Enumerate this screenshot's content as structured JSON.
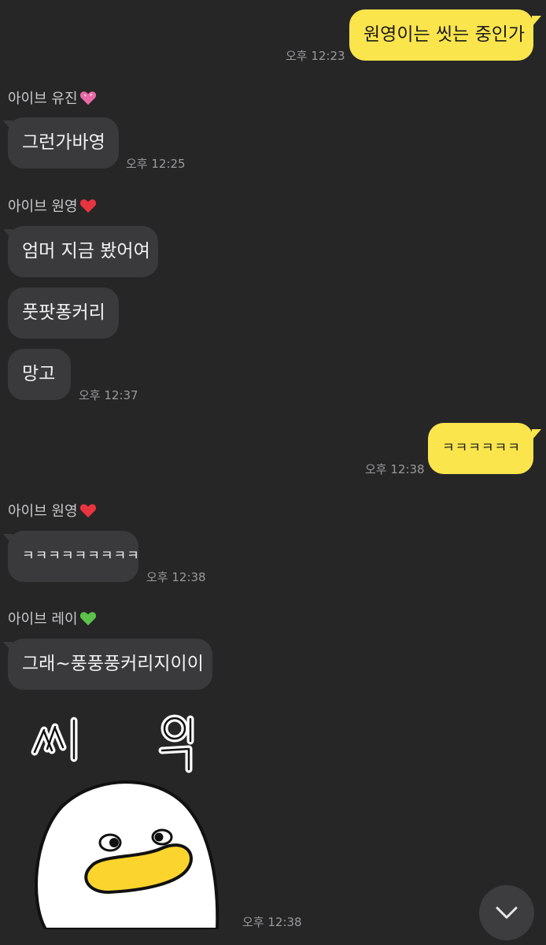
{
  "messages": {
    "m1": {
      "text": "원영이는 씻는 중인가",
      "time": "오후 12:23"
    },
    "n1": {
      "name": "아이브 유진"
    },
    "m2": {
      "text": "그런가바영",
      "time": "오후 12:25"
    },
    "n2": {
      "name": "아이브 원영"
    },
    "m3": {
      "text": "엄머 지금 봤어여"
    },
    "m4": {
      "text": "풋팟퐁커리"
    },
    "m5": {
      "text": "망고",
      "time": "오후 12:37"
    },
    "m6": {
      "text": "ㅋㅋㅋㅋㅋㅋ",
      "time": "오후 12:38"
    },
    "n3": {
      "name": "아이브 원영"
    },
    "m7": {
      "text": "ㅋㅋㅋㅋㅋㅋㅋㅋㅋ",
      "time": "오후 12:38"
    },
    "n4": {
      "name": "아이브 레이"
    },
    "m8": {
      "text": "그래~풍풍풍커리지이이"
    },
    "sticker": {
      "caption": "씨 익",
      "time": "오후 12:38"
    }
  },
  "colors": {
    "background": "#262627",
    "my_bubble": "#fbe54d",
    "other_bubble": "#3a3a3c",
    "pink_heart": "#e96aa6",
    "red_heart": "#e8343f",
    "green_heart": "#5cc34a"
  },
  "icons": {
    "scroll_down": "chevron-down-icon"
  }
}
